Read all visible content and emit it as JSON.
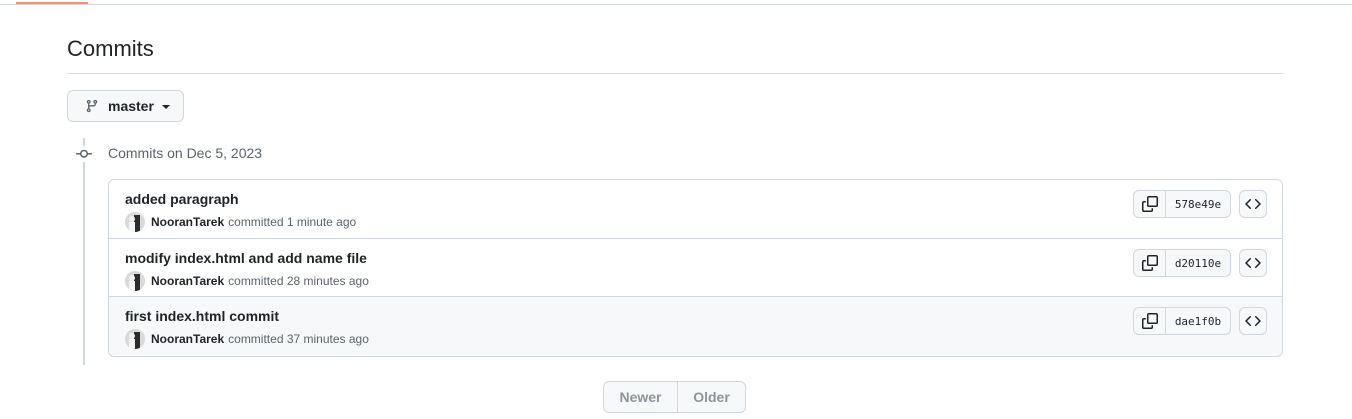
{
  "page": {
    "title": "Commits"
  },
  "branch": {
    "name": "master"
  },
  "group": {
    "heading": "Commits on Dec 5, 2023"
  },
  "commits": [
    {
      "title": "added paragraph",
      "author": "NooranTarek",
      "time": "committed 1 minute ago",
      "sha": "578e49e"
    },
    {
      "title": "modify index.html and add name file",
      "author": "NooranTarek",
      "time": "committed 28 minutes ago",
      "sha": "d20110e"
    },
    {
      "title": "first index.html commit",
      "author": "NooranTarek",
      "time": "committed 37 minutes ago",
      "sha": "dae1f0b"
    }
  ],
  "pagination": {
    "newer": "Newer",
    "older": "Older"
  },
  "icons": {
    "branch": "git-branch-icon",
    "commit_node": "git-commit-icon",
    "copy": "copy-icon",
    "browse": "code-icon",
    "caret": "triangle-down-icon"
  },
  "colors": {
    "accent_underline": "#fd8c73",
    "border": "#d0d7de",
    "muted_text": "#59636e",
    "disabled_text": "#8c959f"
  }
}
